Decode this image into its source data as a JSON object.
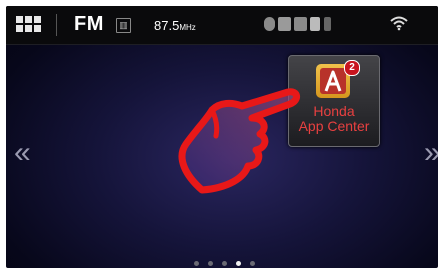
{
  "status_bar": {
    "home_icon": "grid-icon",
    "source": "FM",
    "signal_icon": "hd-radio-icon",
    "frequency": "87.5",
    "frequency_unit": "MHz",
    "status_icons": [
      "phone-battery-icon",
      "message-icon",
      "signal-icon",
      "phone-icon",
      "bluetooth-icon"
    ],
    "wifi_icon": "wifi-icon"
  },
  "nav": {
    "prev_arrow": "«",
    "next_arrow": "»"
  },
  "app": {
    "name_line1": "Honda",
    "name_line2": "App Center",
    "badge_count": "2",
    "icon_letter": "A",
    "accent_color": "#e84040"
  },
  "page_indicator": {
    "total": 5,
    "active_index": 3
  },
  "gesture": {
    "icon": "pointing-hand-icon",
    "color": "#e81818"
  }
}
